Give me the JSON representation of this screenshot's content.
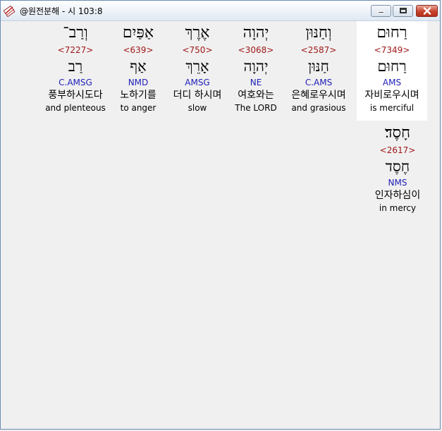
{
  "window": {
    "title": "@원전분해 - 시 103:8"
  },
  "words": [
    {
      "hebrew": "רַחוּם",
      "strong": "<7349>",
      "lemma": "רַחוּם",
      "morph": "AMS",
      "korean": "자비로우시며",
      "english": "is merciful"
    },
    {
      "hebrew": "וְחַנּוּן",
      "strong": "<2587>",
      "lemma": "חַנּוּן",
      "morph": "C.AMS",
      "korean": "은혜로우시며",
      "english": "and grasious"
    },
    {
      "hebrew": "יְהוָה",
      "strong": "<3068>",
      "lemma": "יְהוָה",
      "morph": "NE",
      "korean": "여호와는",
      "english": "The LORD"
    },
    {
      "hebrew": "אֶרֶךְ",
      "strong": "<750>",
      "lemma": "אָרֵךְ",
      "morph": "AMSG",
      "korean": "더디 하시며",
      "english": "slow"
    },
    {
      "hebrew": "אַפַּיִם",
      "strong": "<639>",
      "lemma": "אַף",
      "morph": "NMD",
      "korean": "노하기를",
      "english": "to anger"
    },
    {
      "hebrew": "וְרַב־",
      "strong": "<7227>",
      "lemma": "רַב",
      "morph": "C.AMSG",
      "korean": "풍부하시도다",
      "english": "and plenteous"
    },
    {
      "hebrew": "חָסֶד׃",
      "strong": "<2617>",
      "lemma": "חֶסֶד",
      "morph": "NMS",
      "korean": "인자하심이",
      "english": "in mercy"
    }
  ]
}
